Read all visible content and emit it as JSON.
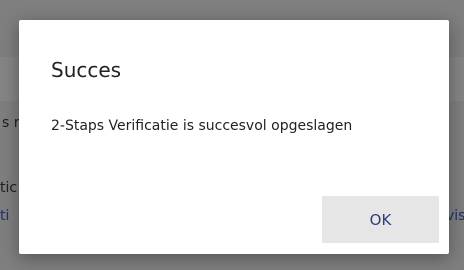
{
  "background": {
    "fragments": [
      "s r",
      "tic",
      "ti",
      "vis"
    ]
  },
  "dialog": {
    "title": "Succes",
    "message": "2-Staps Verificatie is succesvol opgeslagen",
    "ok_label": "OK"
  },
  "colors": {
    "backdrop": "#7f7f7f",
    "dialog_bg": "#ffffff",
    "button_bg": "#e6e6e6",
    "button_text": "#2d3e86"
  }
}
